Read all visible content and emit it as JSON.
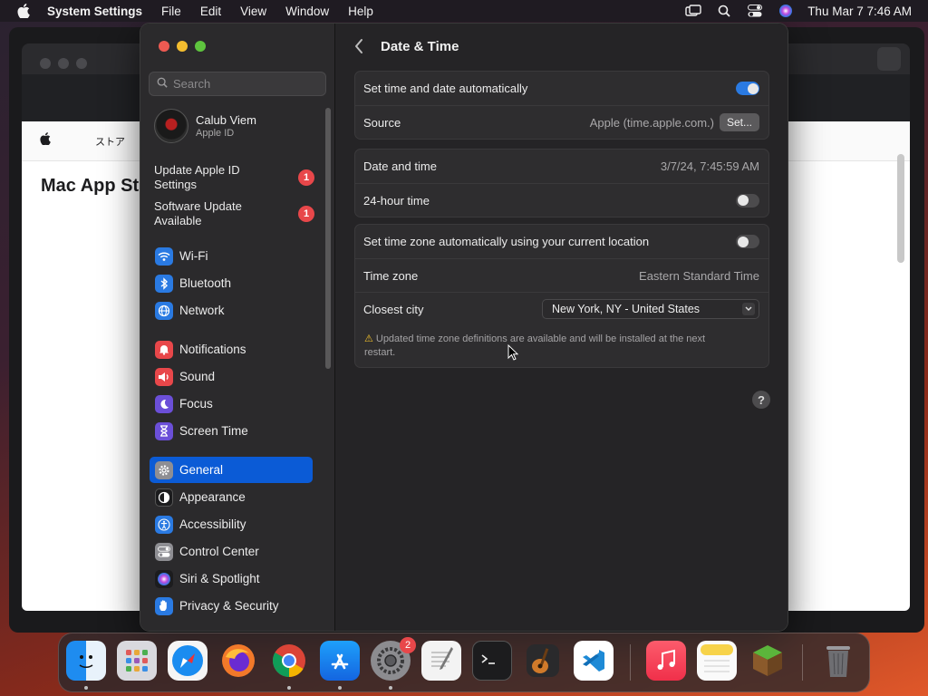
{
  "menubar": {
    "app_name": "System Settings",
    "menus": [
      "File",
      "Edit",
      "View",
      "Window",
      "Help"
    ],
    "clock": "Thu Mar 7  7:46 AM"
  },
  "background_window": {
    "store_tab": "ストア",
    "store_title": "Mac App St"
  },
  "sidebar": {
    "search_placeholder": "Search",
    "profile": {
      "name": "Calub Viem",
      "subtitle": "Apple ID"
    },
    "notices": [
      {
        "label": "Update Apple ID Settings",
        "badge": "1"
      },
      {
        "label": "Software Update Available",
        "badge": "1"
      }
    ],
    "items": [
      {
        "label": "Wi-Fi",
        "icon": "wifi-icon",
        "color": "#2a7ae2"
      },
      {
        "label": "Bluetooth",
        "icon": "bluetooth-icon",
        "color": "#2a7ae2"
      },
      {
        "label": "Network",
        "icon": "globe-icon",
        "color": "#2a7ae2"
      },
      {
        "label": "Notifications",
        "icon": "bell-icon",
        "color": "#e8474a"
      },
      {
        "label": "Sound",
        "icon": "speaker-icon",
        "color": "#e8474a"
      },
      {
        "label": "Focus",
        "icon": "moon-icon",
        "color": "#6b4fd8"
      },
      {
        "label": "Screen Time",
        "icon": "hourglass-icon",
        "color": "#6b4fd8"
      },
      {
        "label": "General",
        "icon": "gear-icon",
        "color": "#8e8e93"
      },
      {
        "label": "Appearance",
        "icon": "appearance-icon",
        "color": "#1c1c1e"
      },
      {
        "label": "Accessibility",
        "icon": "accessibility-icon",
        "color": "#2a7ae2"
      },
      {
        "label": "Control Center",
        "icon": "control-center-icon",
        "color": "#8e8e93"
      },
      {
        "label": "Siri & Spotlight",
        "icon": "siri-icon",
        "color": "#b04ad8"
      },
      {
        "label": "Privacy & Security",
        "icon": "hand-icon",
        "color": "#2a7ae2"
      }
    ],
    "active_item": "General"
  },
  "main": {
    "title": "Date & Time",
    "auto_time": {
      "label": "Set time and date automatically",
      "enabled": true
    },
    "source": {
      "label": "Source",
      "value": "Apple (time.apple.com.)",
      "button": "Set..."
    },
    "date_time": {
      "label": "Date and time",
      "value": "3/7/24, 7:45:59 AM"
    },
    "hour24": {
      "label": "24-hour time",
      "enabled": false
    },
    "auto_timezone": {
      "label": "Set time zone automatically using your current location",
      "enabled": false
    },
    "timezone": {
      "label": "Time zone",
      "value": "Eastern Standard Time"
    },
    "closest_city": {
      "label": "Closest city",
      "value": "New York, NY - United States"
    },
    "warning": "Updated time zone definitions are available and will be installed at the next restart.",
    "help": "?"
  },
  "dock": {
    "apps": [
      "Finder",
      "Launchpad",
      "Safari",
      "Firefox",
      "Chrome",
      "App Store",
      "System Settings",
      "TextEdit",
      "Terminal",
      "GarageBand",
      "Visual Studio Code",
      "Music",
      "Notes",
      "Minecraft",
      "Trash"
    ],
    "system_settings_badge": "2"
  }
}
